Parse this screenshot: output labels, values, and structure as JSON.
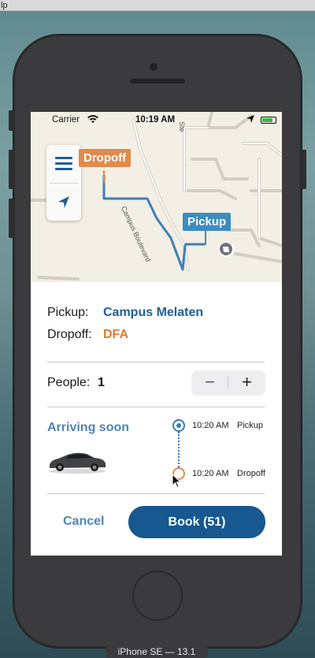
{
  "host": {
    "title_fragment": "lp",
    "simulator_label": "iPhone SE — 13.1"
  },
  "status_bar": {
    "carrier": "Carrier",
    "time": "10:19 AM"
  },
  "map": {
    "dropoff_pin": "Dropoff",
    "pickup_pin": "Pickup",
    "street_1": "Campus Boulevard",
    "street_2": "Ste"
  },
  "trip": {
    "pickup_label": "Pickup:",
    "pickup_value": "Campus Melaten",
    "dropoff_label": "Dropoff:",
    "dropoff_value": "DFA",
    "people_label": "People:",
    "people_value": "1",
    "stepper_minus": "−",
    "stepper_plus": "+"
  },
  "arrival": {
    "status": "Arriving soon",
    "pickup_time": "10:20 AM",
    "pickup_tag": "Pickup",
    "dropoff_time": "10:20 AM",
    "dropoff_tag": "Dropoff"
  },
  "actions": {
    "cancel": "Cancel",
    "book": "Book (51)"
  },
  "colors": {
    "primary_blue": "#16588f",
    "link_blue": "#4d86b7",
    "pickup_blue": "#3c8dc0",
    "dropoff_orange": "#e08b4b",
    "value_blue": "#1f5f93",
    "value_orange": "#e07a2e"
  },
  "icons": [
    "wifi-icon",
    "location-arrow-icon",
    "battery-icon",
    "menu-icon",
    "navigation-arrow-icon",
    "poi-icon",
    "car-image",
    "mouse-cursor-icon"
  ]
}
